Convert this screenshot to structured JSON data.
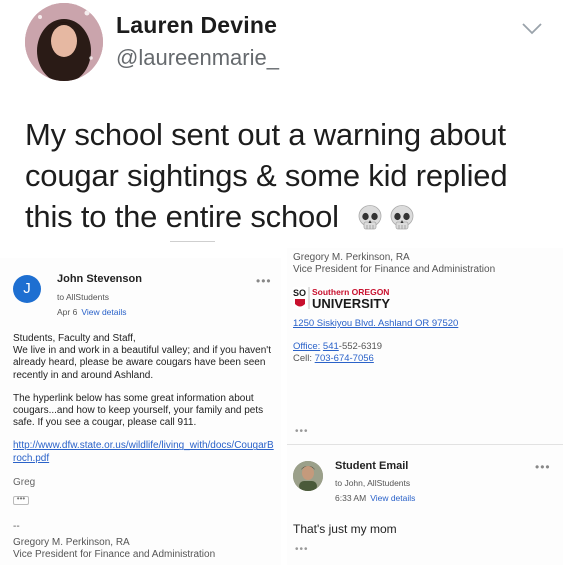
{
  "tweet": {
    "display_name": "Lauren Devine",
    "handle": "@laureenmarie_",
    "text": "My school sent out a warning about cougar sightings & some kid replied this to the entire school",
    "emoji": [
      "skull-icon",
      "skull-icon"
    ]
  },
  "email_1": {
    "avatar_letter": "J",
    "sender": "John Stevenson",
    "to": "to AllStudents",
    "date": "Apr 6",
    "view_details": "View details",
    "more": "•••",
    "body": [
      "Students, Faculty and Staff,\nWe live in and work in a beautiful valley; and if you haven't already heard, please be aware cougars have been seen recently in and around Ashland.",
      "The hyperlink below has some great information about cougars...and how to keep yourself, your family and pets safe.  If you see a cougar, please call 911."
    ],
    "link": "http://www.dfw.state.or.us/wildlife/living_with/docs/CougarBroch.pdf",
    "signoff": "Greg",
    "quoted_toggle": "•••",
    "sig_dash": "--",
    "sig_name": "Gregory M. Perkinson, RA",
    "sig_title": "Vice President for Finance and Administration"
  },
  "signature": {
    "name": "Gregory M. Perkinson, RA",
    "title": "Vice President for Finance and Administration",
    "logo_mark": "SO",
    "logo_top": "Southern OREGON",
    "logo_bottom": "UNIVERSITY",
    "address": "1250 Siskiyou Blvd. Ashland  OR 97520",
    "office_label": "Office:",
    "office_prefix": "541",
    "office_rest": "-552-6319",
    "cell_label": "Cell:",
    "cell_number": "703-674-7056",
    "more": "•••"
  },
  "email_2": {
    "sender": "Student Email",
    "to": "to John, AllStudents",
    "time": "6:33 AM",
    "view_details": "View details",
    "more": "•••",
    "reply": "That's just my mom",
    "quoted_toggle": "•••"
  },
  "colors": {
    "link_blue": "#2a62c9",
    "avatar_blue": "#1e6fd1",
    "sou_red": "#c8102e"
  }
}
